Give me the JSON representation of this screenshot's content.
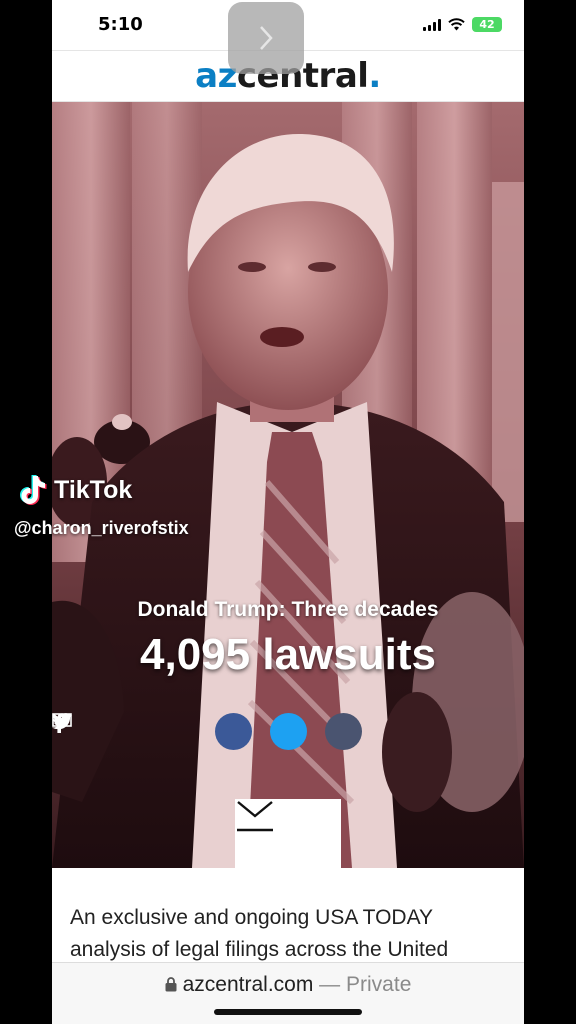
{
  "status_bar": {
    "time": "5:10",
    "battery": "42"
  },
  "site": {
    "logo_az": "az",
    "logo_central": "central",
    "logo_dot": "."
  },
  "hero": {
    "subtitle": "Donald Trump: Three decades",
    "title": "4,095 lawsuits",
    "share_buttons": [
      "facebook-icon",
      "twitter-icon",
      "mail-icon"
    ]
  },
  "article": {
    "text": "An exclusive and ongoing USA TODAY analysis of legal filings across the United"
  },
  "browser": {
    "domain": "azcentral.com",
    "separator": " — ",
    "mode": "Private"
  },
  "overlay": {
    "brand": "TikTok",
    "handle": "@charon_riverofstix"
  },
  "colors": {
    "brand_blue": "#0b7fc4",
    "facebook": "#3b5998",
    "twitter": "#1da1f2",
    "mail": "#4a5470"
  }
}
